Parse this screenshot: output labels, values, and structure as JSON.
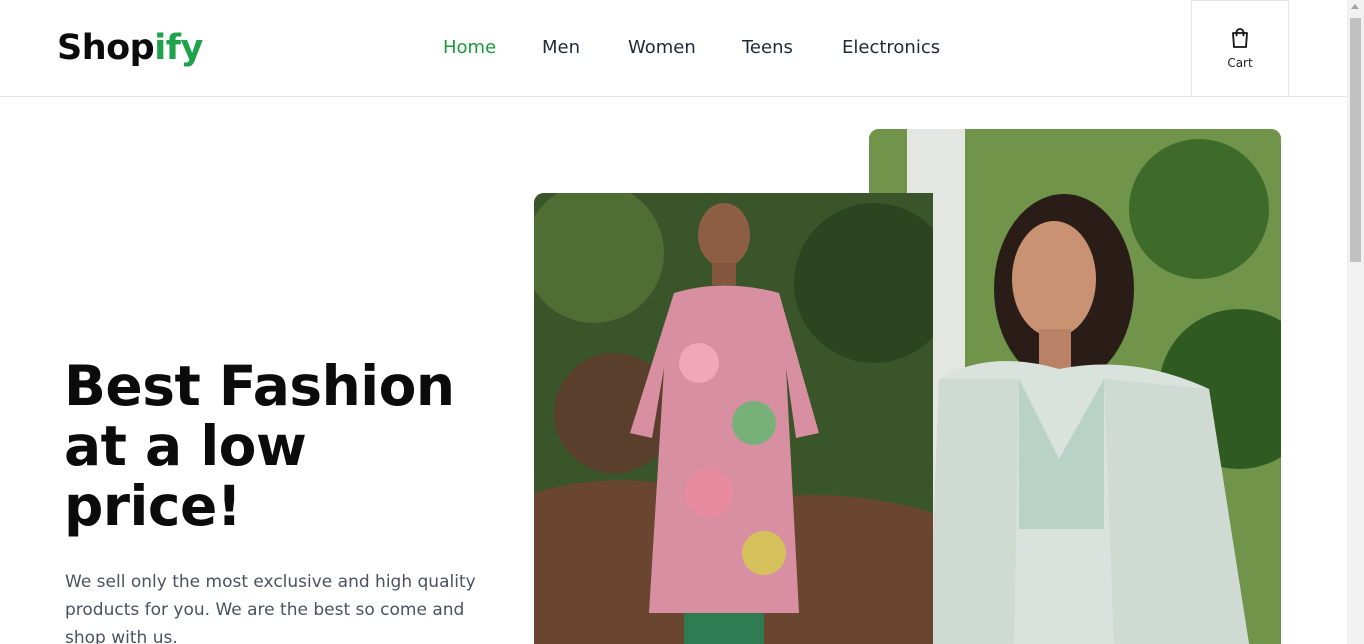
{
  "header": {
    "logo": {
      "part1": "Shop",
      "part2": "ify"
    },
    "nav": [
      {
        "label": "Home",
        "active": true
      },
      {
        "label": "Men",
        "active": false
      },
      {
        "label": "Women",
        "active": false
      },
      {
        "label": "Teens",
        "active": false
      },
      {
        "label": "Electronics",
        "active": false
      }
    ],
    "cart": {
      "label": "Cart",
      "icon": "shopping-bag-icon"
    }
  },
  "hero": {
    "title": "Best Fashion at a low price!",
    "description": "We sell only the most exclusive and high quality products for you. We are the best so come and shop with us."
  },
  "images": {
    "man": "man-in-floral-kurta-photo",
    "woman": "woman-in-mint-outfit-photo"
  },
  "colors": {
    "accent": "#1fa34a",
    "nav_active": "#1b9a3d",
    "text": "#0b0b0b",
    "muted": "#4a5260"
  }
}
